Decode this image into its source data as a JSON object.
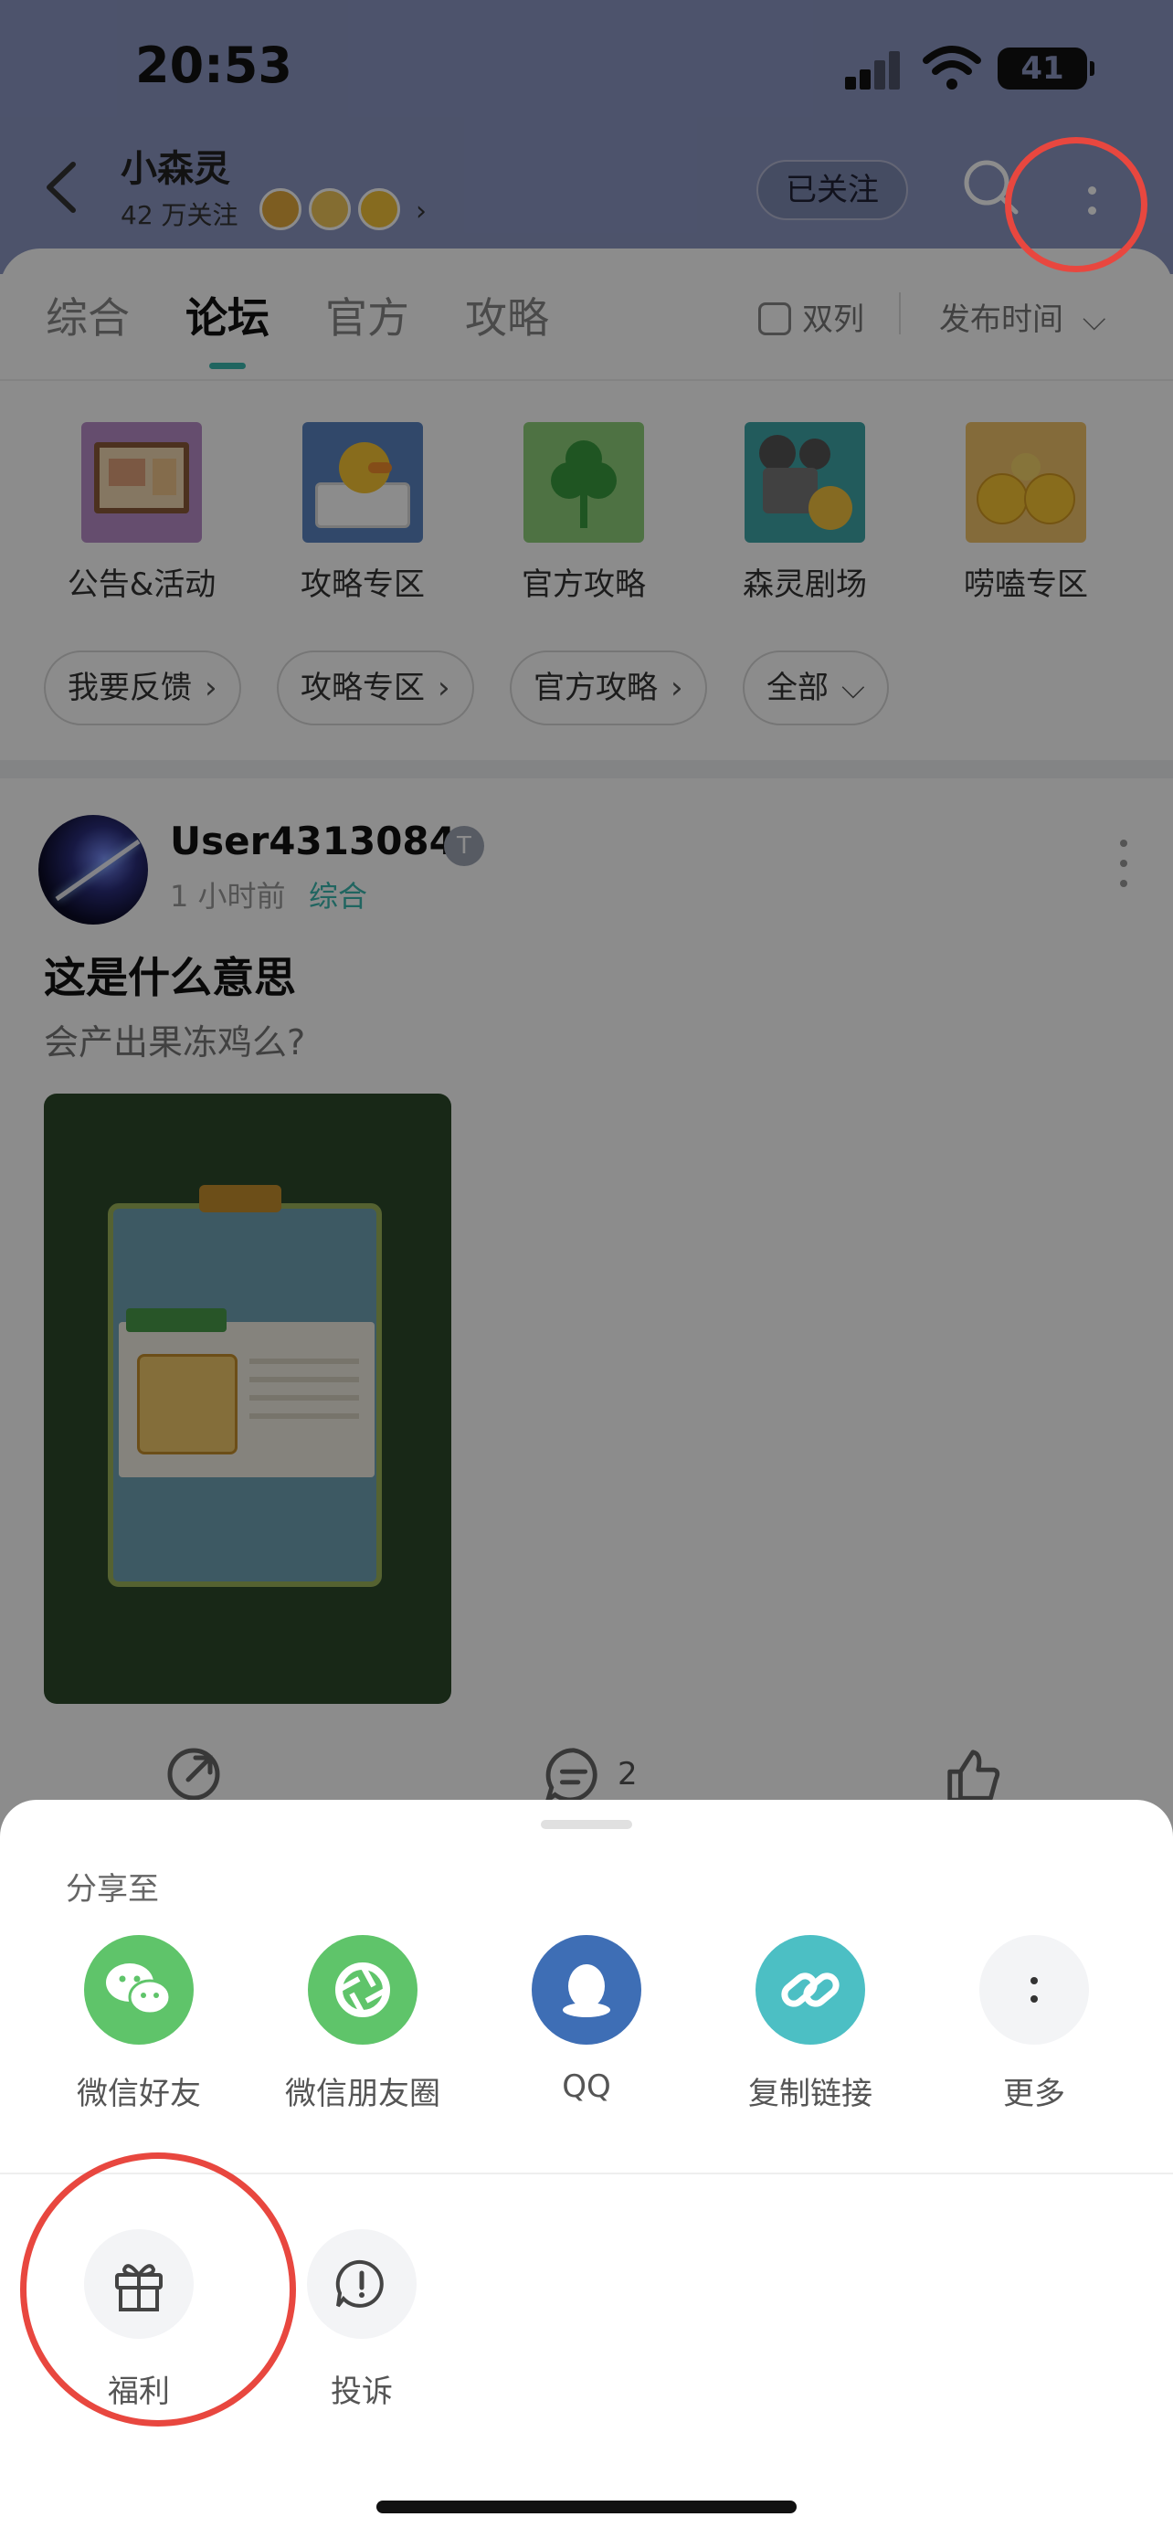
{
  "status": {
    "time": "20:53",
    "battery": "41"
  },
  "header": {
    "forum_name": "小森灵",
    "followers": "42 万关注",
    "follow_label": "已关注"
  },
  "tabs": [
    "综合",
    "论坛",
    "官方",
    "攻略"
  ],
  "active_tab": "论坛",
  "filters": {
    "dual_label": "双列",
    "sort_label": "发布时间"
  },
  "categories": [
    "公告&活动",
    "攻略专区",
    "官方攻略",
    "森灵剧场",
    "唠嗑专区"
  ],
  "chips": [
    "我要反馈",
    "攻略专区",
    "官方攻略",
    "全部"
  ],
  "post": {
    "username": "User4313084",
    "level": "T",
    "time": "1 小时前",
    "category": "综合",
    "title": "这是什么意思",
    "body": "会产出果冻鸡么?",
    "comment_count": "2"
  },
  "share_sheet": {
    "title": "分享至",
    "targets": [
      {
        "label": "微信好友",
        "icon": "wechat-icon",
        "color": "#5fc46a"
      },
      {
        "label": "微信朋友圈",
        "icon": "moments-icon",
        "color": "#5fc46a"
      },
      {
        "label": "QQ",
        "icon": "qq-icon",
        "color": "#3e6eb5"
      },
      {
        "label": "复制链接",
        "icon": "link-icon",
        "color": "#4cbfc4"
      },
      {
        "label": "更多",
        "icon": "more-icon",
        "color": "#f3f4f6"
      }
    ],
    "actions": [
      {
        "label": "福利",
        "icon": "gift-icon"
      },
      {
        "label": "投诉",
        "icon": "report-icon"
      }
    ]
  },
  "colors": {
    "accent": "#3bb8b0",
    "header_bg": "#8d97c4",
    "highlight": "#e8473f"
  }
}
